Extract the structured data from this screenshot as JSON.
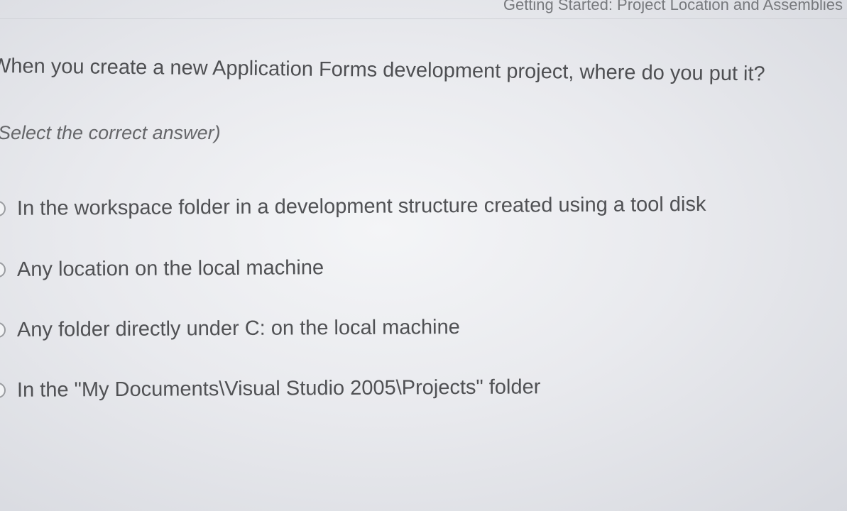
{
  "header": {
    "title": "Getting Started: Project Location and Assemblies"
  },
  "question": {
    "text": "When you create a new Application Forms development project, where do you put it?",
    "instruction": "(Select the correct answer)"
  },
  "options": [
    {
      "label": "In the workspace folder in a development structure created using a tool disk"
    },
    {
      "label": "Any location on the local machine"
    },
    {
      "label": "Any folder directly under C: on the local machine"
    },
    {
      "label": "In the \"My Documents\\Visual Studio 2005\\Projects\" folder"
    }
  ]
}
